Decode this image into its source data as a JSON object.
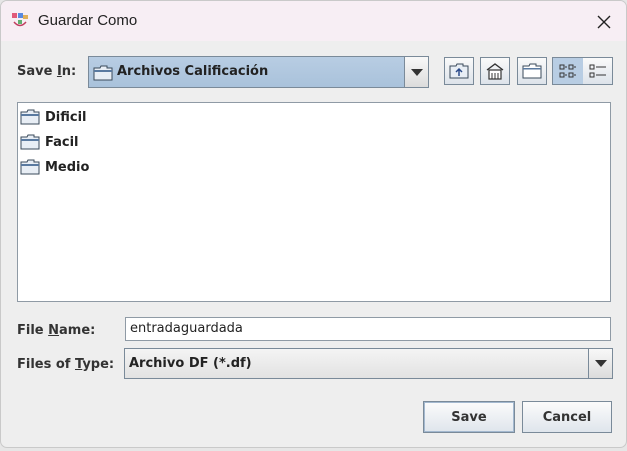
{
  "window": {
    "title": "Guardar Como"
  },
  "look_in": {
    "label_pre": "Save ",
    "label_mnemonic": "I",
    "label_post": "n:",
    "value": "Archivos Calificación"
  },
  "toolbar": {
    "icons": [
      "up-one-level-icon",
      "home-icon",
      "new-folder-icon",
      "list-view-icon",
      "details-view-icon"
    ]
  },
  "files": [
    {
      "name": "Dificil",
      "icon": "folder-icon"
    },
    {
      "name": "Facil",
      "icon": "folder-icon"
    },
    {
      "name": "Medio",
      "icon": "folder-icon"
    }
  ],
  "file_name": {
    "label_pre": "File ",
    "label_mnemonic": "N",
    "label_post": "ame:",
    "value": "entradaguardada"
  },
  "file_type": {
    "label_pre": "Files of ",
    "label_mnemonic": "T",
    "label_post": "ype:",
    "value": "Archivo DF (*.df)"
  },
  "buttons": {
    "save": "Save",
    "cancel": "Cancel"
  },
  "colors": {
    "selection": "#b8cde3",
    "border": "#7a8a99",
    "title_bar": "#f7eef4"
  }
}
